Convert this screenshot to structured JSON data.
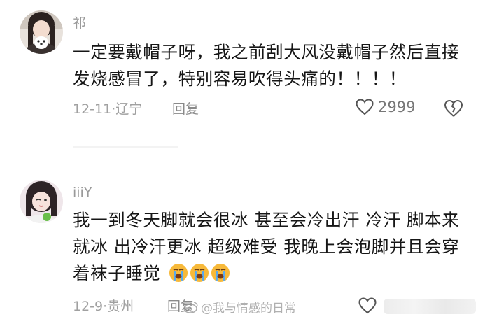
{
  "comments": [
    {
      "username": "祁",
      "lines": [
        "一定要戴帽子呀，我之前刮大风没戴帽子然后直接",
        "发烧感冒了，特别容易吹得头痛的！！！！"
      ],
      "date": "12-11",
      "location": "辽宁",
      "reply_label": "回复",
      "like_count": "2999",
      "icons": {
        "like": "heart-icon",
        "dislike": "broken-heart-icon"
      }
    },
    {
      "username": "iiiY",
      "lines": [
        "我一到冬天脚就会很冰 甚至会冷出汗 冷汗 脚本来",
        "就冰 出冷汗更冰 超级难受 我晚上会泡脚并且会穿",
        "着袜子睡觉"
      ],
      "emoji_count": 3,
      "emoji_name": "loudly-crying-emoji",
      "date": "12-9",
      "location": "贵州",
      "reply_label": "回复",
      "icons": {
        "like": "heart-icon"
      }
    }
  ],
  "watermark": {
    "text": "@我与情感的日常",
    "icon": "weibo-logo-icon"
  },
  "colors": {
    "text": "#161616",
    "meta": "#a0a0a0",
    "username": "#9a9a9a",
    "emoji": "#f7b93a"
  }
}
